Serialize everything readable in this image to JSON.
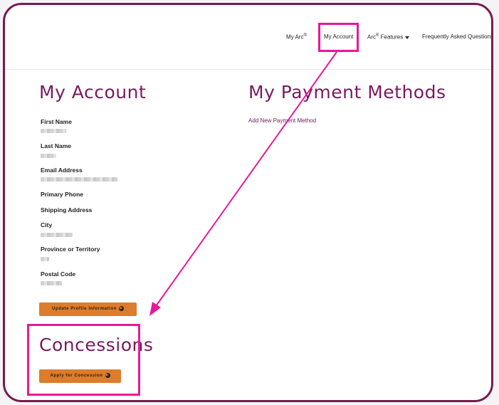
{
  "nav": {
    "my_arc": "My Arc",
    "my_arc_sup": "®",
    "my_account": "My Account",
    "features": "Arc",
    "features_sup": "®",
    "features_suffix": " Features",
    "faq": "Frequently Asked Questions"
  },
  "account": {
    "title": "My Account",
    "fields": [
      {
        "label": "First Name"
      },
      {
        "label": "Last Name"
      },
      {
        "label": "Email Address"
      },
      {
        "label": "Primary Phone"
      },
      {
        "label": "Shipping Address"
      },
      {
        "label": "City"
      },
      {
        "label": "Province or Territory"
      },
      {
        "label": "Postal Code"
      }
    ],
    "update_button": "Update Profile Information"
  },
  "payment": {
    "title": "My Payment Methods",
    "add_link": "Add New Payment Method"
  },
  "concessions": {
    "title": "Concessions",
    "apply_button": "Apply for Concession"
  },
  "colors": {
    "heading": "#7a1a5f",
    "button": "#dd7c2a",
    "highlight": "#e8189a",
    "frame": "#7a1a4f"
  }
}
